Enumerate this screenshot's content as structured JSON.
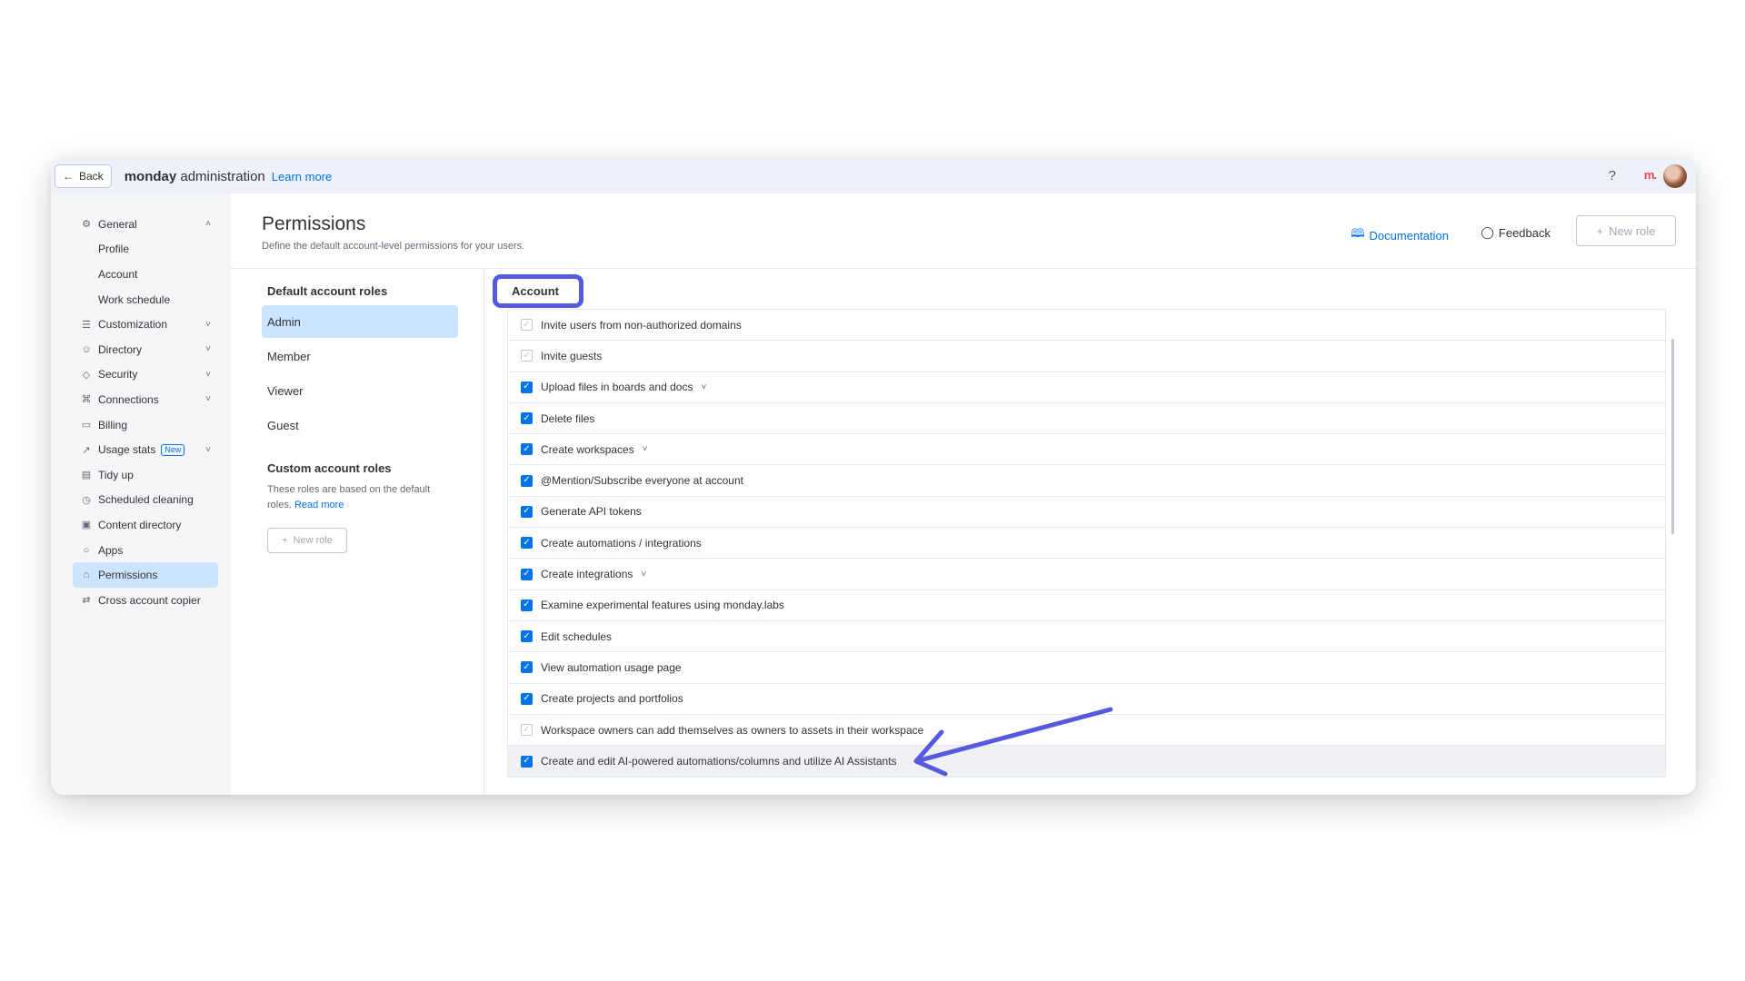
{
  "topbar": {
    "back_label": "Back",
    "brand_bold": "monday",
    "brand_rest": " administration",
    "learn_more": "Learn more",
    "help_icon": "?",
    "logo_text": "m."
  },
  "sidebar": {
    "items": [
      {
        "label": "General",
        "icon": "gear-icon",
        "chevron": "up"
      },
      {
        "label": "Profile",
        "sub": true
      },
      {
        "label": "Account",
        "sub": true
      },
      {
        "label": "Work schedule",
        "sub": true
      },
      {
        "label": "Customization",
        "icon": "sliders-icon",
        "chevron": "down"
      },
      {
        "label": "Directory",
        "icon": "people-icon",
        "chevron": "down"
      },
      {
        "label": "Security",
        "icon": "shield-icon",
        "chevron": "down"
      },
      {
        "label": "Connections",
        "icon": "connections-icon",
        "chevron": "down"
      },
      {
        "label": "Billing",
        "icon": "card-icon"
      },
      {
        "label": "Usage stats",
        "icon": "chart-icon",
        "badge": "New",
        "chevron": "down"
      },
      {
        "label": "Tidy up",
        "icon": "tidy-icon"
      },
      {
        "label": "Scheduled cleaning",
        "icon": "clock-icon"
      },
      {
        "label": "Content directory",
        "icon": "content-icon"
      },
      {
        "label": "Apps",
        "icon": "apps-icon"
      },
      {
        "label": "Permissions",
        "icon": "lock-icon",
        "active": true
      },
      {
        "label": "Cross account copier",
        "icon": "copy-icon"
      }
    ]
  },
  "header": {
    "title": "Permissions",
    "subtitle": "Define the default account-level permissions for your users.",
    "documentation": "Documentation",
    "feedback": "Feedback",
    "new_role": "New role"
  },
  "roles": {
    "default_heading": "Default account roles",
    "default_items": [
      "Admin",
      "Member",
      "Viewer",
      "Guest"
    ],
    "active_role": "Admin",
    "custom_heading": "Custom account roles",
    "custom_desc": "These roles are based on the default roles.",
    "read_more": "Read more",
    "new_role": "New role"
  },
  "permissions": {
    "section": "Account",
    "items": [
      {
        "label": "Invite users from non-authorized domains",
        "checked": false
      },
      {
        "label": "Invite guests",
        "checked": false
      },
      {
        "label": "Upload files in boards and docs",
        "checked": true,
        "dropdown": true
      },
      {
        "label": "Delete files",
        "checked": true
      },
      {
        "label": "Create workspaces",
        "checked": true,
        "dropdown": true
      },
      {
        "label": "@Mention/Subscribe everyone at account",
        "checked": true
      },
      {
        "label": "Generate API tokens",
        "checked": true
      },
      {
        "label": "Create automations / integrations",
        "checked": true
      },
      {
        "label": "Create integrations",
        "checked": true,
        "dropdown": true
      },
      {
        "label": "Examine experimental features using monday.labs",
        "checked": true
      },
      {
        "label": "Edit schedules",
        "checked": true
      },
      {
        "label": "View automation usage page",
        "checked": true
      },
      {
        "label": "Create projects and portfolios",
        "checked": true
      },
      {
        "label": "Workspace owners can add themselves as owners to assets in their workspace",
        "checked": false
      },
      {
        "label": "Create and edit AI-powered automations/columns and utilize AI Assistants",
        "checked": true,
        "highlight": true
      }
    ]
  },
  "colors": {
    "accent": "#0073ea",
    "highlight_ring": "#5559df",
    "annotation_arrow": "#5559df",
    "active_bg": "#cce5ff"
  }
}
